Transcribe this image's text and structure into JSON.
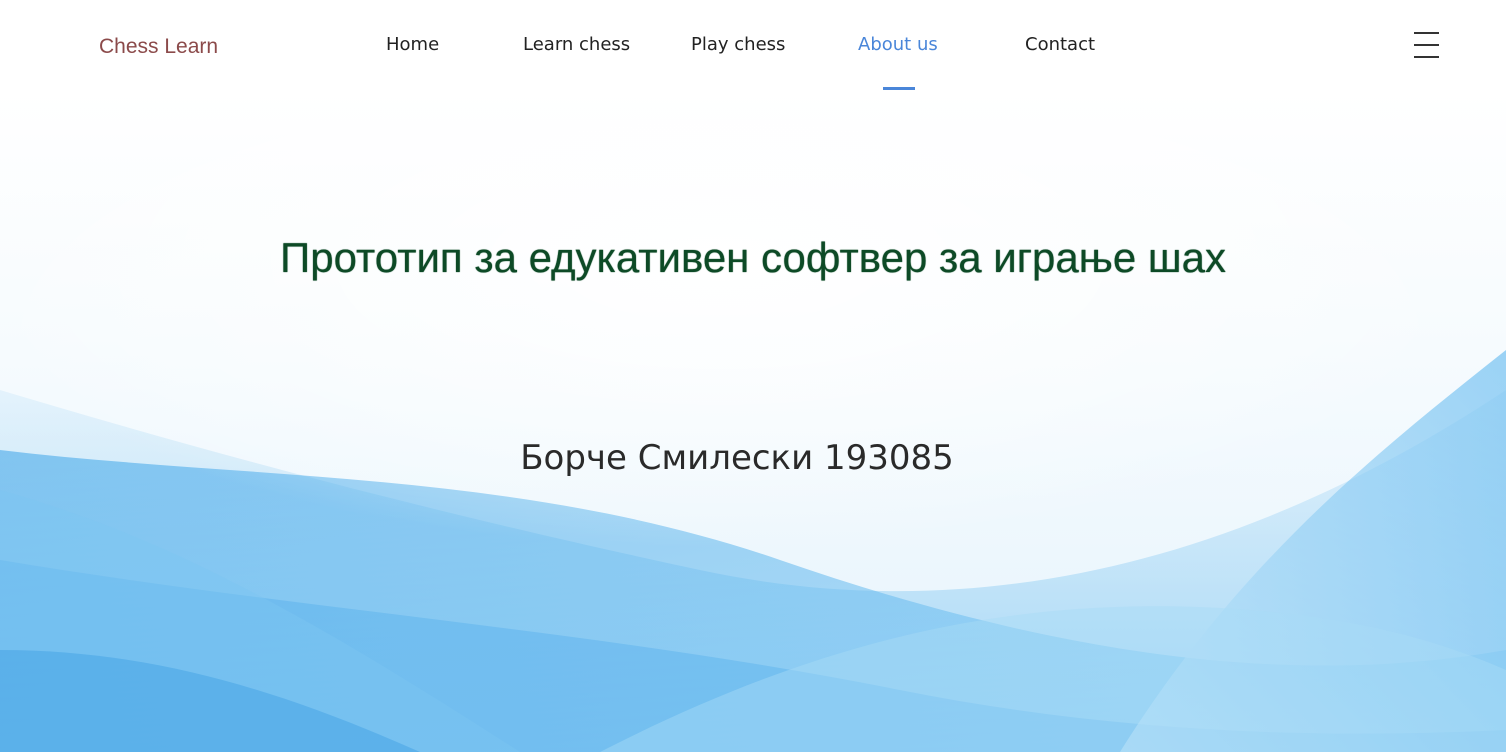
{
  "brand": "Chess Learn",
  "nav": {
    "items": [
      {
        "label": "Home",
        "active": false
      },
      {
        "label": "Learn chess",
        "active": false
      },
      {
        "label": "Play chess",
        "active": false
      },
      {
        "label": "About us",
        "active": true
      },
      {
        "label": "Contact",
        "active": false
      }
    ]
  },
  "hero": {
    "title": "Прототип за едукативен софтвер за играње шах",
    "subtitle": "Борче Смилески 193085"
  },
  "colors": {
    "brand": "#8b4a4a",
    "accent": "#4a86d9",
    "title": "#0d4a26"
  },
  "icons": {
    "menu": "hamburger-icon"
  }
}
